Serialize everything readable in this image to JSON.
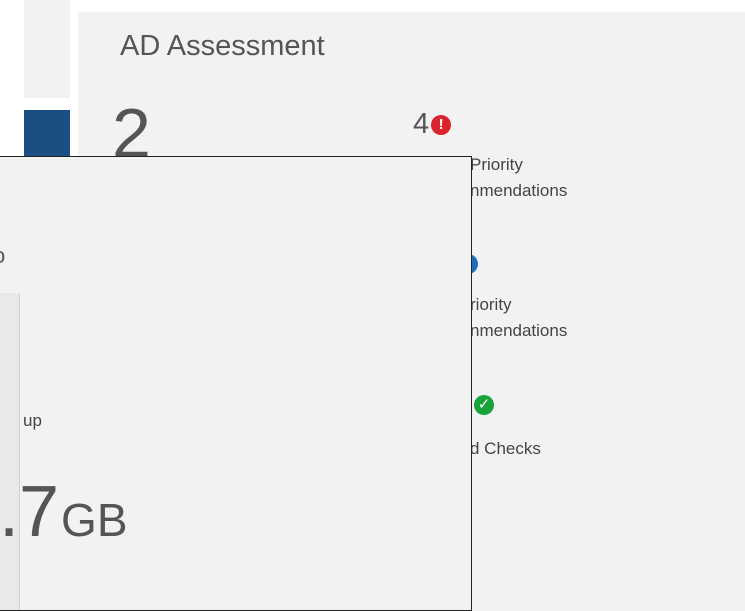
{
  "ad_assessment": {
    "title": "AD Assessment",
    "big_number": "2",
    "high_priority": {
      "count": "4",
      "label_line1": "Priority",
      "label_line2": "nmendations",
      "icon": "exclamation-circle-icon",
      "color": "#d9232d"
    },
    "low_priority": {
      "label_line1": "riority",
      "label_line2": "nmendations",
      "icon": "info-circle-icon",
      "color": "#1f6fc0"
    },
    "passed": {
      "label": "d Checks",
      "icon": "check-circle-icon",
      "color": "#1aa33d"
    }
  },
  "backup": {
    "label": "up",
    "size_value": ".7",
    "size_unit": "GB",
    "edge_glyph": "o"
  },
  "colors": {
    "tile_background": "#f2f2f2",
    "accent": "#1b4f83",
    "overlay_border": "#222222"
  }
}
